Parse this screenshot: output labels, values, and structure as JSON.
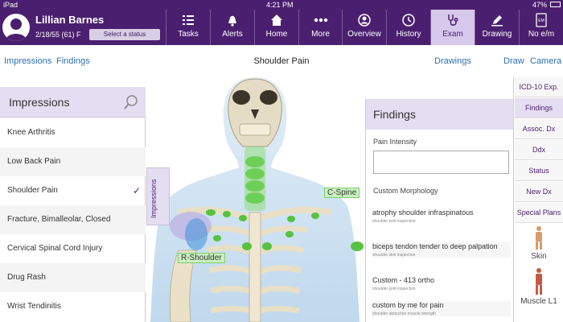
{
  "statusbar": {
    "device": "iPad",
    "time": "4:21 PM",
    "battery": "47%"
  },
  "patient": {
    "name": "Lillian Barnes",
    "dob": "2/18/55 (61) F",
    "status_button": "Select a status"
  },
  "nav": [
    {
      "label": "Tasks",
      "icon": "tasks-icon"
    },
    {
      "label": "Alerts",
      "icon": "alerts-icon"
    },
    {
      "label": "Home",
      "icon": "home-icon"
    },
    {
      "label": "More",
      "icon": "more-icon"
    },
    {
      "label": "Overview",
      "icon": "overview-icon"
    },
    {
      "label": "History",
      "icon": "history-icon"
    },
    {
      "label": "Exam",
      "icon": "stethoscope-icon",
      "active": true
    },
    {
      "label": "Drawing",
      "icon": "drawing-icon"
    },
    {
      "label": "No e/m",
      "icon": "em-icon"
    }
  ],
  "subbar": {
    "left1": "Impressions",
    "left2": "Findings",
    "title": "Shoulder Pain",
    "drawings": "Drawings",
    "draw": "Draw",
    "camera": "Camera"
  },
  "impressions": {
    "title": "Impressions",
    "tab_label": "Impressions",
    "items": [
      "Knee Arthritis",
      "Low Back Pain",
      "Shoulder Pain",
      "Fracture, Bimalleolar, Closed",
      "Cervical Spinal Cord Injury",
      "Drug Rash",
      "Wrist Tendinitis"
    ],
    "checkmark": "✓"
  },
  "findings": {
    "title": "Findings",
    "pain_label": "Pain Intensity",
    "morph_label": "Custom Morphology",
    "items": [
      {
        "text": "atrophy shoulder infraspinatous",
        "sub": "shoulder joint inspection"
      },
      {
        "text": "biceps tendon tender to deep palpation",
        "sub": "shoulder skin inspection"
      },
      {
        "text": "Custom - 413 ortho",
        "sub": "shoulder joint inspection"
      },
      {
        "text": "custom by me for pain",
        "sub": "shoulder abduction muscle strength"
      }
    ]
  },
  "body_labels": {
    "c_spine": "C-Spine",
    "r_shoulder": "R-Shoulder"
  },
  "right_col": {
    "buttons": [
      "ICD-10 Exp.",
      "Findings",
      "Assoc. Dx",
      "Ddx",
      "Status",
      "New Dx",
      "Special Plans"
    ],
    "thumb1": "Skin",
    "thumb2": "Muscle L1"
  },
  "colors": {
    "brand": "#4b1f6f",
    "accent_light": "#e4def2",
    "highlight": "#56c23f"
  }
}
